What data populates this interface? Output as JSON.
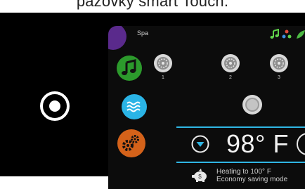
{
  "caption": "pazovky smart Touch.",
  "screen": {
    "title": "Spa",
    "jets": [
      {
        "label": "1"
      },
      {
        "label": "2"
      },
      {
        "label": "3"
      }
    ],
    "temperature": "98° F",
    "heating": {
      "line1": "Heating to 100° F",
      "line2": "Economy saving mode"
    }
  },
  "colors": {
    "accent": "#2fb6e4",
    "spa_nav": "#5a2a8c",
    "music_nav": "#2c9a2c",
    "water_nav": "#2ab4e6",
    "settings_nav": "#d4621a"
  },
  "icons": {
    "home": "home-button-icon",
    "spa": "spa-icon",
    "music": "music-note-icon",
    "water": "water-waves-icon",
    "settings": "gears-icon",
    "status_music": "music-note-icon",
    "status_jets": "jets-icon",
    "status_leaf": "leaf-icon",
    "jet": "jet-pump-icon",
    "light": "light-icon",
    "temp_down": "chevron-down-icon",
    "economy": "piggy-bank-icon"
  }
}
